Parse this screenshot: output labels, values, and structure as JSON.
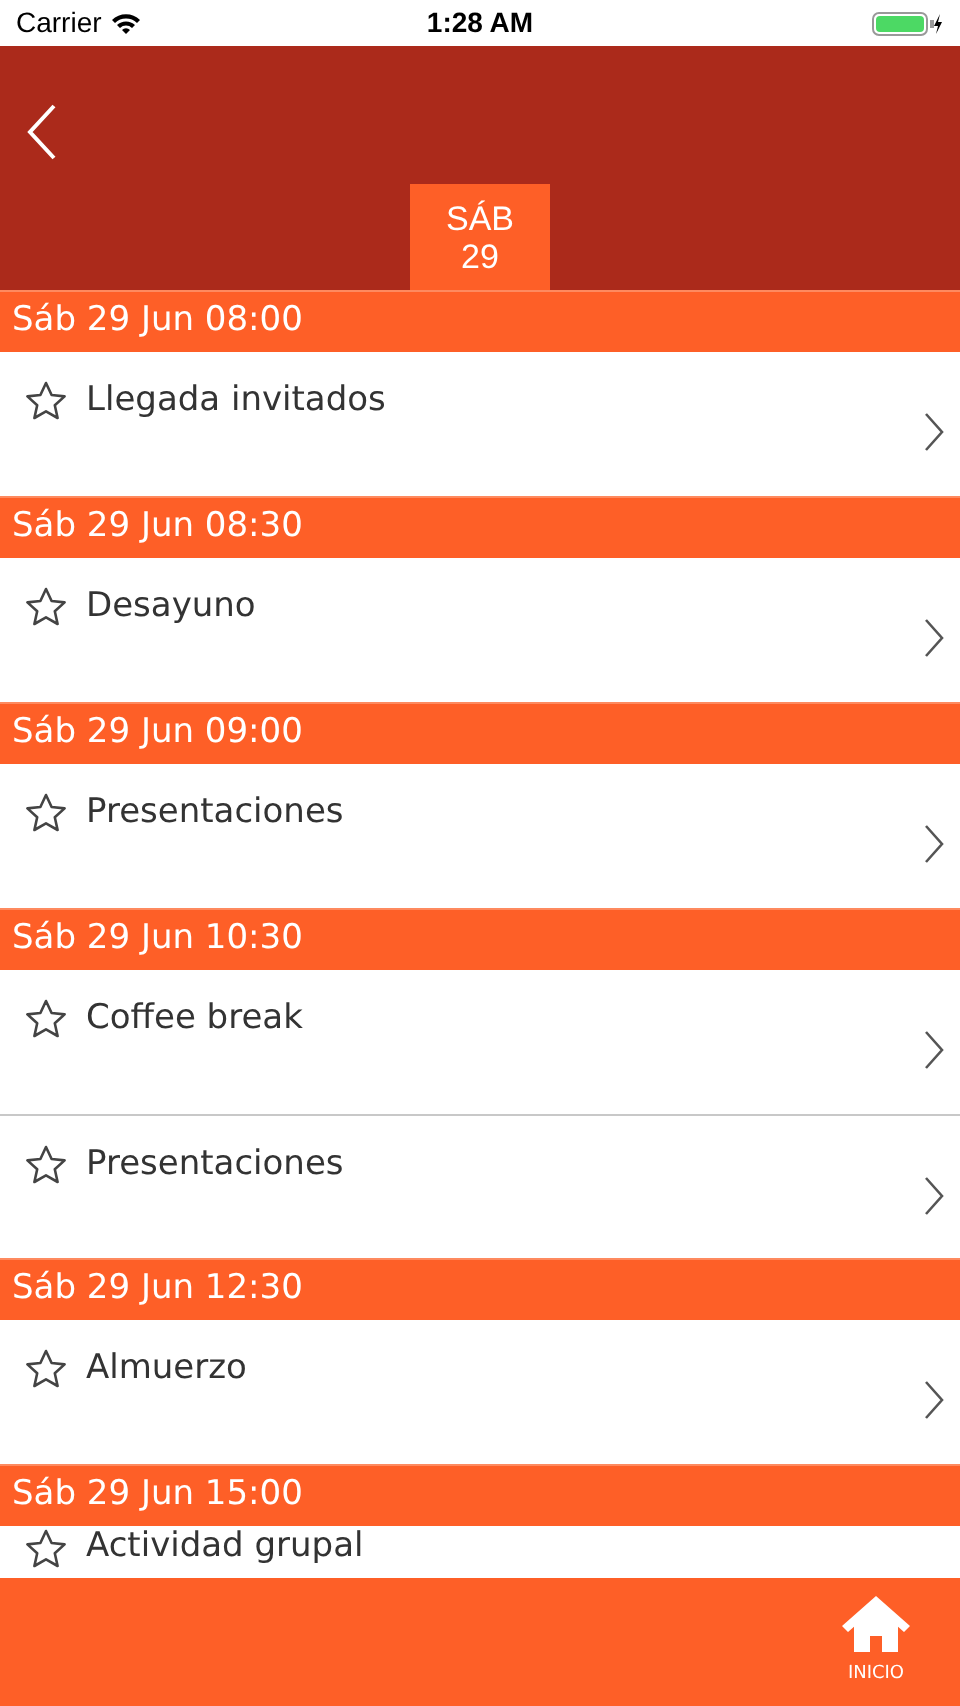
{
  "status_bar": {
    "carrier": "Carrier",
    "time": "1:28 AM"
  },
  "day_tabs": [
    {
      "weekday": "SÁB",
      "day": "29",
      "selected": true
    }
  ],
  "sections": [
    {
      "header": "Sáb 29 Jun 08:00",
      "items": [
        {
          "title": "Llegada invitados",
          "favorite": false
        }
      ]
    },
    {
      "header": "Sáb 29 Jun 08:30",
      "items": [
        {
          "title": "Desayuno",
          "favorite": false
        }
      ]
    },
    {
      "header": "Sáb 29 Jun 09:00",
      "items": [
        {
          "title": "Presentaciones",
          "favorite": false
        }
      ]
    },
    {
      "header": "Sáb 29 Jun 10:30",
      "items": [
        {
          "title": "Coffee break",
          "favorite": false
        },
        {
          "title": "Presentaciones",
          "favorite": false
        }
      ]
    },
    {
      "header": "Sáb 29 Jun 12:30",
      "items": [
        {
          "title": "Almuerzo",
          "favorite": false
        }
      ]
    },
    {
      "header": "Sáb 29 Jun 15:00",
      "items": [
        {
          "title": "Actividad grupal",
          "favorite": false
        }
      ]
    }
  ],
  "tab_bar": [
    {
      "label": "INICIO",
      "selected": true
    }
  ]
}
